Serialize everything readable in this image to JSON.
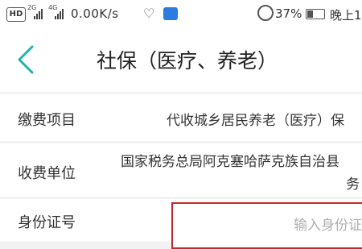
{
  "status_bar": {
    "hd_label": "HD",
    "sim1_network": "2G",
    "sim2_network": "4G",
    "network_speed": "0.00K/s",
    "battery_percent": "37%",
    "time": "晚上1"
  },
  "header": {
    "title": "社保（医疗、养老）"
  },
  "form": {
    "rows": [
      {
        "label": "缴费项目",
        "value": "代收城乡居民养老（医疗）保"
      },
      {
        "label": "收费单位",
        "value_line1": "国家税务总局阿克塞哈萨克族自治县",
        "value_line2": "务"
      },
      {
        "label": "身份证号",
        "placeholder": "输入身份证"
      }
    ]
  },
  "colors": {
    "accent": "#1fb5a6",
    "input_border": "#c0292f",
    "background": "#f2f2f2"
  }
}
